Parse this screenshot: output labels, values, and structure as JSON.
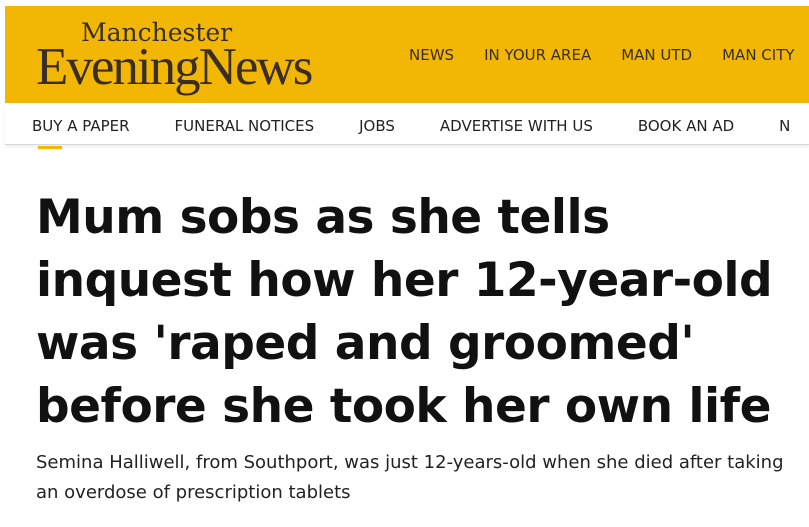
{
  "brand": {
    "name_top": "Manchester",
    "name_main": "EveningNews",
    "color_background": "#f2b705",
    "color_text": "#3a2e22"
  },
  "main_nav": {
    "items": [
      "NEWS",
      "IN YOUR AREA",
      "MAN UTD",
      "MAN CITY"
    ]
  },
  "secondary_nav": {
    "items": [
      "BUY A PAPER",
      "FUNERAL NOTICES",
      "JOBS",
      "ADVERTISE WITH US",
      "BOOK AN AD",
      "N"
    ]
  },
  "article": {
    "headline": "Mum sobs as she tells inquest how her 12-year-old was 'raped and groomed' before she took her own life",
    "standfirst": "Semina Halliwell, from Southport, was just 12-years-old when she died after taking an overdose of prescription tablets"
  }
}
